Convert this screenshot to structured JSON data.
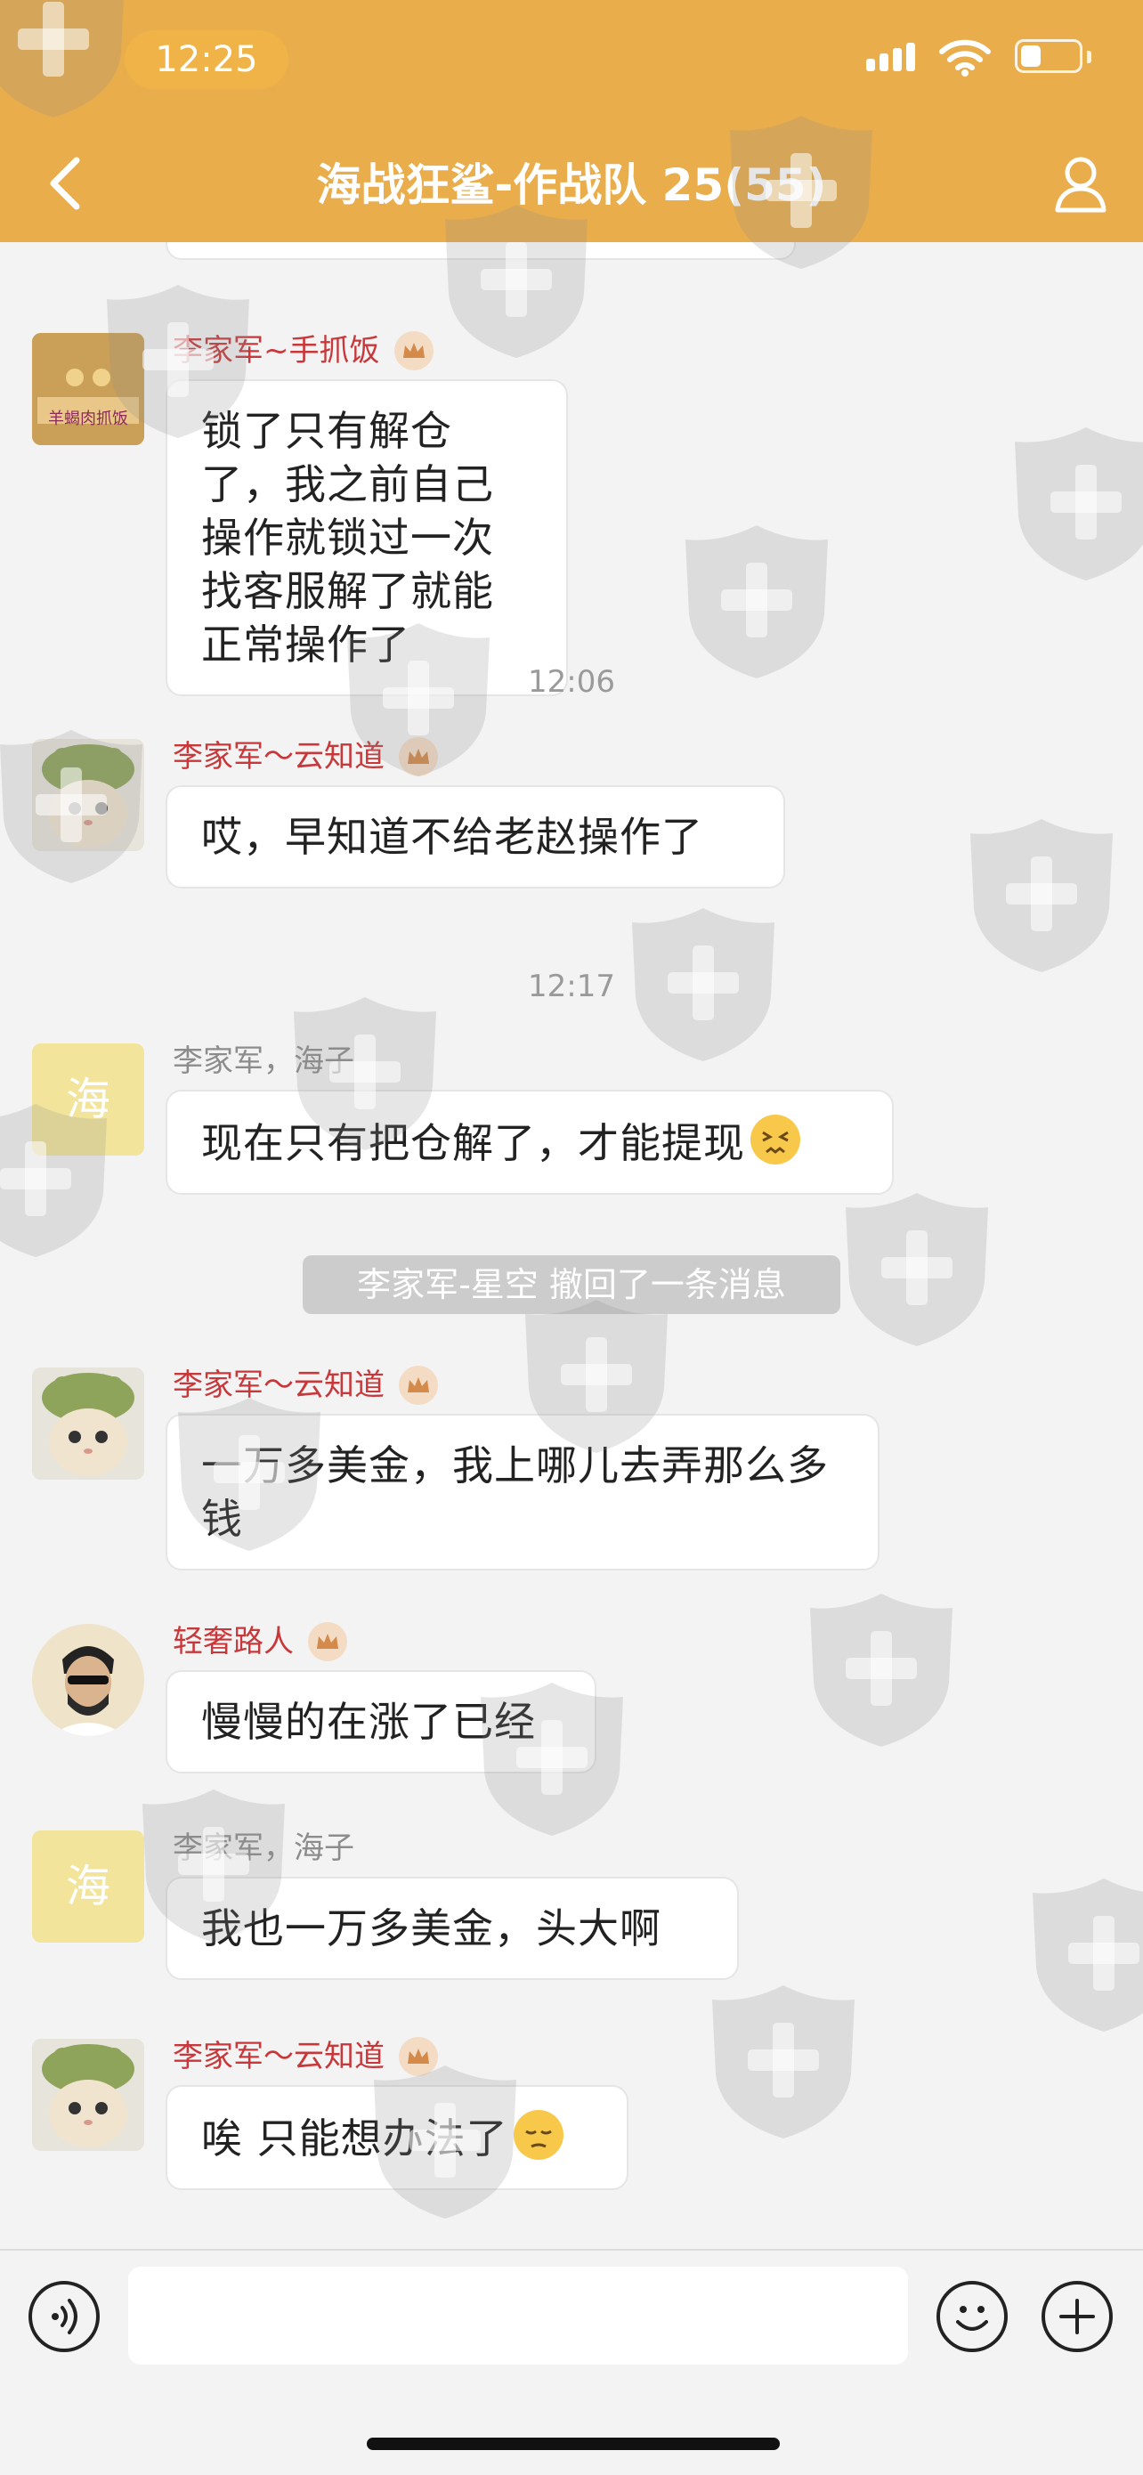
{
  "status_bar": {
    "time": "12:25",
    "battery_level": 0.35
  },
  "header": {
    "title": "海战狂鲨-作战队 25(55)"
  },
  "watermark_icon": "shield-cross-icon",
  "colors": {
    "header": "#e9ad4c",
    "sender_red": "#c8383a",
    "sender_gray": "#8c8c8c",
    "system_note": "#cccccc"
  },
  "messages": [
    {
      "sender": "李家军~手抓饭",
      "text": "锁了只有解仓了，我之前自己操作就锁过一次找客服解了就能正常操作了",
      "avatar_text": "羊蝎肉抓饭"
    },
    {
      "time": "12:06"
    },
    {
      "sender": "李家军～云知道",
      "text": "哎，早知道不给老赵操作了"
    },
    {
      "time": "12:17"
    },
    {
      "sender": "李家军，海子",
      "avatar_text": "海",
      "text": "现在只有把仓解了，才能提现"
    },
    {
      "system": "李家军-星空 撤回了一条消息"
    },
    {
      "sender": "李家军～云知道",
      "text": "一万多美金，我上哪儿去弄那么多钱"
    },
    {
      "sender": "轻奢路人",
      "text": "慢慢的在涨了已经"
    },
    {
      "sender": "李家军，海子",
      "avatar_text": "海",
      "text": "我也一万多美金，头大啊"
    },
    {
      "sender": "李家军～云知道",
      "text": "唉 只能想办法了"
    }
  ],
  "input": {
    "placeholder": ""
  }
}
